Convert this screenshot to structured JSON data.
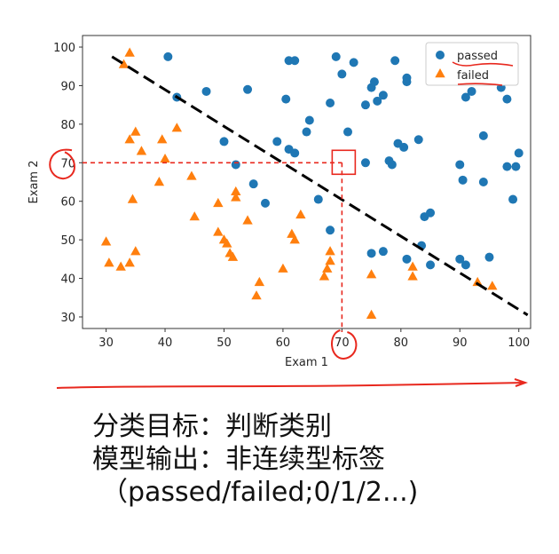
{
  "chart_data": {
    "type": "scatter",
    "xlabel": "Exam 1",
    "ylabel": "Exam 2",
    "xlim": [
      26,
      102
    ],
    "ylim": [
      27,
      103
    ],
    "xticks": [
      30,
      40,
      50,
      60,
      70,
      80,
      90,
      100
    ],
    "yticks": [
      30,
      40,
      50,
      60,
      70,
      80,
      90,
      100
    ],
    "grid": false,
    "legend_position": "top-right",
    "series": [
      {
        "name": "passed",
        "marker": "circle",
        "color": "#1f77b4",
        "points": [
          [
            40.5,
            97.5
          ],
          [
            42,
            87
          ],
          [
            47,
            88.5
          ],
          [
            54,
            89
          ],
          [
            50,
            75.5
          ],
          [
            52,
            69.5
          ],
          [
            55,
            64.5
          ],
          [
            57,
            59.5
          ],
          [
            59,
            75.5
          ],
          [
            60.5,
            86.5
          ],
          [
            61,
            96.5
          ],
          [
            62,
            96.5
          ],
          [
            61,
            73.5
          ],
          [
            62,
            72.5
          ],
          [
            64,
            78
          ],
          [
            64.5,
            81
          ],
          [
            66,
            60.5
          ],
          [
            68,
            85.5
          ],
          [
            69,
            97.5
          ],
          [
            70,
            93
          ],
          [
            71,
            78
          ],
          [
            72,
            96
          ],
          [
            74,
            70
          ],
          [
            74,
            85
          ],
          [
            75,
            89.5
          ],
          [
            75.5,
            91
          ],
          [
            76,
            86
          ],
          [
            77,
            87.5
          ],
          [
            78,
            70.5
          ],
          [
            78.5,
            69.5
          ],
          [
            79,
            96.5
          ],
          [
            79.5,
            75
          ],
          [
            80.5,
            74
          ],
          [
            81,
            91
          ],
          [
            81,
            92
          ],
          [
            83,
            76
          ],
          [
            83.5,
            48.5
          ],
          [
            84,
            56
          ],
          [
            85,
            57
          ],
          [
            85,
            43.5
          ],
          [
            90,
            69.5
          ],
          [
            90,
            45
          ],
          [
            91,
            43.5
          ],
          [
            90.5,
            65.5
          ],
          [
            91,
            87
          ],
          [
            92,
            88.5
          ],
          [
            94,
            77
          ],
          [
            94,
            65
          ],
          [
            95,
            45.5
          ],
          [
            97,
            89.5
          ],
          [
            98,
            86.5
          ],
          [
            98,
            69
          ],
          [
            99,
            60.5
          ],
          [
            99.5,
            69
          ],
          [
            100,
            72.5
          ],
          [
            75,
            46.5
          ],
          [
            77,
            47
          ],
          [
            81,
            45
          ],
          [
            68,
            52.5
          ]
        ]
      },
      {
        "name": "failed",
        "marker": "triangle",
        "color": "#ff7f0e",
        "points": [
          [
            34,
            98.5
          ],
          [
            33,
            95.5
          ],
          [
            34,
            76
          ],
          [
            35,
            78
          ],
          [
            36,
            73
          ],
          [
            34.5,
            60.5
          ],
          [
            30,
            49.5
          ],
          [
            30.5,
            44
          ],
          [
            32.5,
            43
          ],
          [
            34,
            44
          ],
          [
            35,
            47
          ],
          [
            39,
            65
          ],
          [
            40,
            71
          ],
          [
            39.5,
            76
          ],
          [
            42,
            79
          ],
          [
            44.5,
            66.5
          ],
          [
            45,
            56
          ],
          [
            49,
            52
          ],
          [
            49,
            59.5
          ],
          [
            50,
            50
          ],
          [
            50.5,
            49
          ],
          [
            51,
            46.5
          ],
          [
            51.5,
            45.5
          ],
          [
            52,
            62.5
          ],
          [
            52,
            61
          ],
          [
            54,
            55
          ],
          [
            55.5,
            35.5
          ],
          [
            56,
            39
          ],
          [
            60,
            42.5
          ],
          [
            61.5,
            51.5
          ],
          [
            62,
            50
          ],
          [
            63,
            56.5
          ],
          [
            67,
            40.5
          ],
          [
            67.5,
            42.5
          ],
          [
            68,
            44.5
          ],
          [
            68,
            47
          ],
          [
            75,
            41
          ],
          [
            75,
            30.5
          ],
          [
            82,
            40.5
          ],
          [
            82,
            43
          ],
          [
            93,
            39
          ],
          [
            95.5,
            38
          ]
        ]
      }
    ],
    "decision_boundary": {
      "x": [
        31,
        101.5
      ],
      "y": [
        97.5,
        30.5
      ],
      "color": "#000000",
      "style": "dashed"
    },
    "annotation": {
      "point": [
        70,
        70
      ],
      "color": "#e8281e"
    }
  },
  "caption": {
    "line1": "分类目标：判断类别",
    "line2": "模型输出：非连续型标签",
    "line3": "（passed/failed;0/1/2...)"
  },
  "colors": {
    "annotation_red": "#e8281e",
    "passed": "#1f77b4",
    "failed": "#ff7f0e"
  }
}
